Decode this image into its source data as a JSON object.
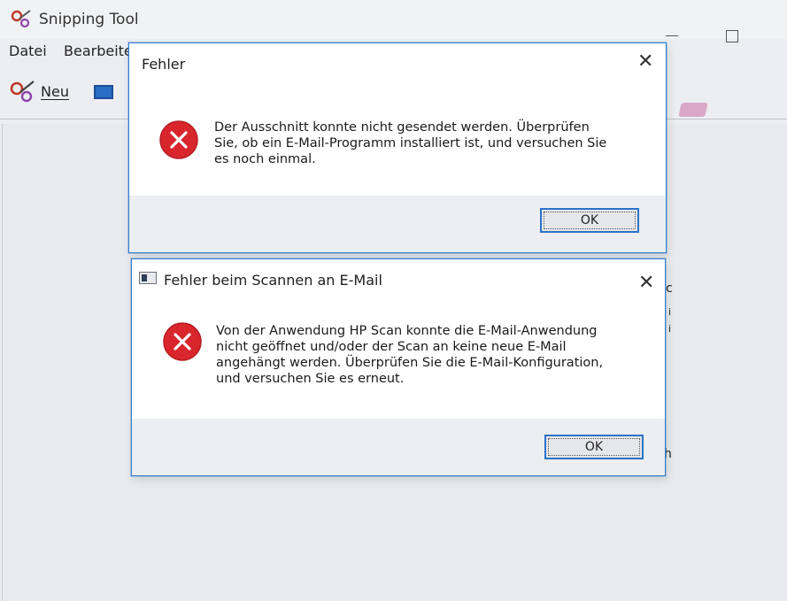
{
  "snipping_tool": {
    "title": "Snipping Tool",
    "menu": {
      "file": "Datei",
      "edit": "Bearbeite"
    },
    "toolbar": {
      "new_label": "Neu"
    },
    "edge_glyphs": [
      "c",
      "i",
      "i",
      "h"
    ]
  },
  "dialog1": {
    "title": "Fehler",
    "close_glyph": "✕",
    "message_lines": [
      "Der Ausschnitt konnte nicht gesendet werden. Überprüfen",
      "Sie, ob ein E-Mail-Programm installiert ist, und versuchen Sie",
      "es noch einmal."
    ],
    "ok_label": "OK"
  },
  "dialog2": {
    "title": "Fehler beim Scannen an E-Mail",
    "close_glyph": "✕",
    "message_lines": [
      "Von der Anwendung HP Scan konnte die E-Mail-Anwendung",
      "nicht geöffnet und/oder der Scan an keine neue E-Mail",
      "angehängt werden. Überprüfen Sie die E-Mail-Konfiguration,",
      "und versuchen Sie es erneut."
    ],
    "ok_label": "OK"
  },
  "icons": {
    "error": "error-icon",
    "app": "scanner-app-icon",
    "logo": "snipping-tool-logo-icon"
  },
  "colors": {
    "accent_blue": "#2a73c9",
    "error_red": "#d8262c"
  }
}
